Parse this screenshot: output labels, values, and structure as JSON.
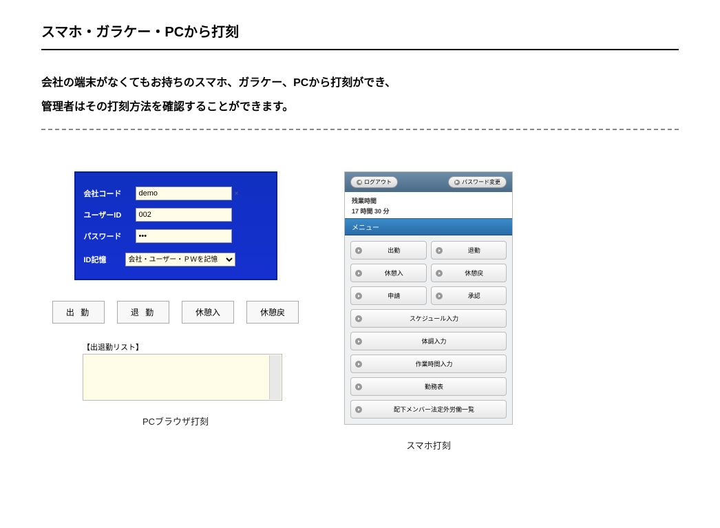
{
  "heading": "スマホ・ガラケー・PCから打刻",
  "description_line1": "会社の端末がなくてもお持ちのスマホ、ガラケー、PCから打刻ができ、",
  "description_line2": "管理者はその打刻方法を確認することができます。",
  "pc": {
    "caption": "PCブラウザ打刻",
    "form": {
      "company_code_label": "会社コード",
      "company_code_value": "demo",
      "user_id_label": "ユーザーID",
      "user_id_value": "002",
      "password_label": "パスワード",
      "password_value": "•••",
      "remember_label": "ID記憶",
      "remember_option": "会社・ユーザー・ＰＷを記憶"
    },
    "buttons": {
      "clock_in": "出 勤",
      "clock_out": "退 勤",
      "break_in": "休憩入",
      "break_out": "休憩戻"
    },
    "list_label": "【出退勤リスト】"
  },
  "phone": {
    "caption": "スマホ打刻",
    "top": {
      "logout": "ログアウト",
      "change_password": "パスワード変更"
    },
    "overtime": {
      "label": "残業時間",
      "value": "17 時間 30 分"
    },
    "menu_header": "メニュー",
    "menu": {
      "clock_in": "出勤",
      "clock_out": "退勤",
      "break_in": "休憩入",
      "break_out": "休憩戻",
      "request": "申請",
      "approve": "承認",
      "schedule": "スケジュール入力",
      "health": "体調入力",
      "worktime": "作業時間入力",
      "roster": "勤務表",
      "subordinate": "配下メンバー法定外労働一覧"
    }
  }
}
